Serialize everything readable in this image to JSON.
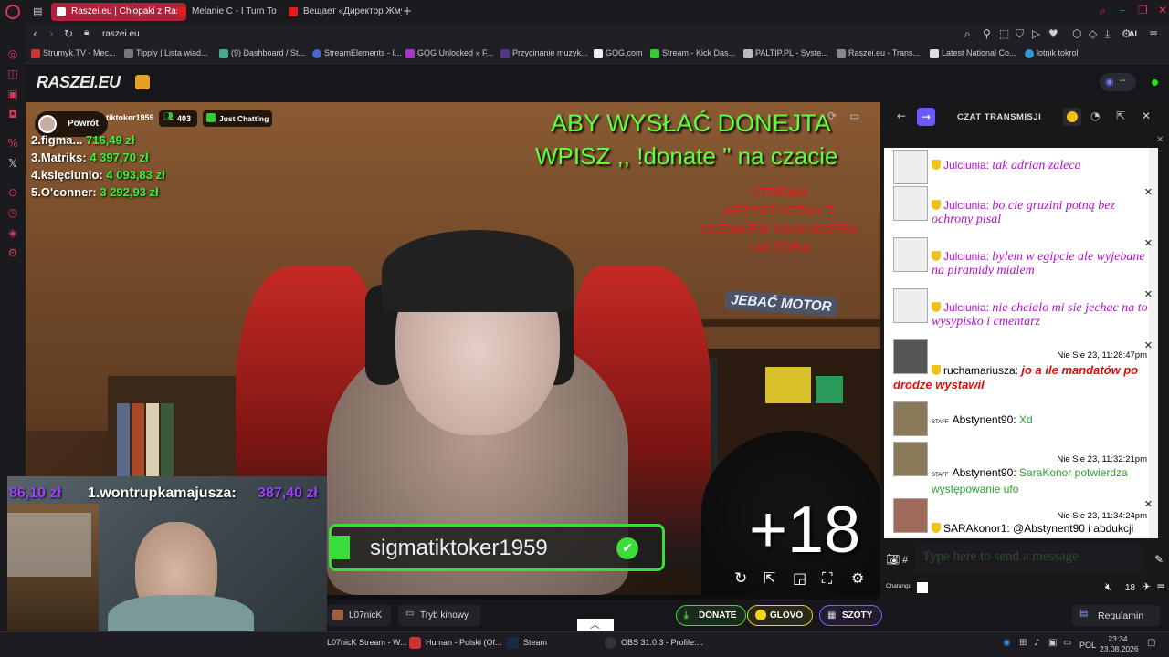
{
  "tabs": [
    {
      "label": "Raszei.eu | Chłopaki z Ras",
      "active": true
    },
    {
      "label": "Melanie C - I Turn To Y",
      "active": false
    },
    {
      "label": "Вещает «Директор Жмур",
      "active": false
    }
  ],
  "address": {
    "url": "raszei.eu"
  },
  "bookmarks": [
    "Strumyk.TV - Mec...",
    "Tipply | Lista wiad...",
    "(9) Dashboard / St...",
    "StreamElements - I...",
    "GOG Unlocked » F...",
    "Przycinanie muzyk...",
    "GOG.com",
    "Stream - Kick Das...",
    "PALTIP.PL - Syste...",
    "Raszei.eu - Trans...",
    "Latest National Co...",
    "lotnik tokrol"
  ],
  "site": {
    "logo": "RASZEI.EU",
    "viewer_toggle": "--"
  },
  "stream": {
    "back_label": "Powrót",
    "channel": "tiktoker1959",
    "viewers": "403",
    "category": "Just Chatting"
  },
  "overlay": {
    "top_donors": [
      {
        "rank": "2.",
        "name": "figma...",
        "amount": "716,49 zł"
      },
      {
        "rank": "3.",
        "name": "Matriks:",
        "amount": "4 397,70 zł"
      },
      {
        "rank": "4.",
        "name": "księciunio:",
        "amount": "4 093,83 zł"
      },
      {
        "rank": "5.",
        "name": "O'conner:",
        "amount": "3 292,93 zł"
      }
    ],
    "donate_line1": "ABY WYSŁAĆ DONEJTA",
    "donate_line2": "WPISZ ,, !donate \" na czacie",
    "stream_desc": [
      "STREAM",
      "ARTYSTYCZNY Z",
      "UDZIAŁEM KASKADERA",
      "I AKTORA"
    ],
    "sticker": "JEBAĆ MOTOR",
    "name_banner": "sigmatiktoker1959",
    "age_badge": "+18",
    "cam_donor_amount": "86,10 zł",
    "cam_donor_name": "1.wontrupkamajusza:",
    "cam_donor_value": "387,40 zł"
  },
  "chat": {
    "title": "CZAT TRANSMISJI",
    "input_placeholder": "Type here to send a message",
    "footer_brand": "Chatango",
    "font_size": "18",
    "messages": [
      {
        "user": "Julciunia:",
        "text": "tak adrian zaleca",
        "ts": "",
        "color": "#b40fd4"
      },
      {
        "user": "Julciunia:",
        "text": "bo cie gruzini potną bez ochrony pisal",
        "ts": "",
        "color": "#b40fd4"
      },
      {
        "user": "Julciunia:",
        "text": "bylem w egipcie ale wyjebane na piramidy mialem",
        "ts": "",
        "color": "#b40fd4"
      },
      {
        "user": "Julciunia:",
        "text": "nie chcialo mi sie jechac na to wysypisko i cmentarz",
        "ts": "",
        "color": "#b40fd4"
      },
      {
        "user": "ruchamariusza:",
        "text": "jo a ile mandatów po drodze wystawil",
        "ts": "Nie Sie 23, 11:28:47pm",
        "color": "#e01010"
      },
      {
        "user": "Abstynent90:",
        "text": "Xd",
        "ts": "",
        "color": "#2f9e2f"
      },
      {
        "user": "Abstynent90:",
        "text": "SaraKonor potwierdza występowanie ufo",
        "ts": "Nie Sie 23, 11:32:21pm",
        "color": "#2f9e2f"
      },
      {
        "user": "SARAkonor1:",
        "text": "@Abstynent90 i abdukcji",
        "ts": "Nie Sie 23, 11:34:24pm",
        "color": "#000000"
      }
    ]
  },
  "bottom": {
    "streamer_tab": "L07nicK",
    "cinema": "Tryb kinowy",
    "donate": "DONATE",
    "glovo": "GLOVO",
    "szoty": "SZOTY",
    "rules": "Regulamin"
  },
  "taskbar": {
    "items": [
      "L07nicK Stream - W...",
      "Human - Polski (Of...",
      "Steam",
      "OBS 31.0.3 - Profile:..."
    ],
    "lang": "POL",
    "time": "23:34",
    "date": "23.08.2026"
  }
}
